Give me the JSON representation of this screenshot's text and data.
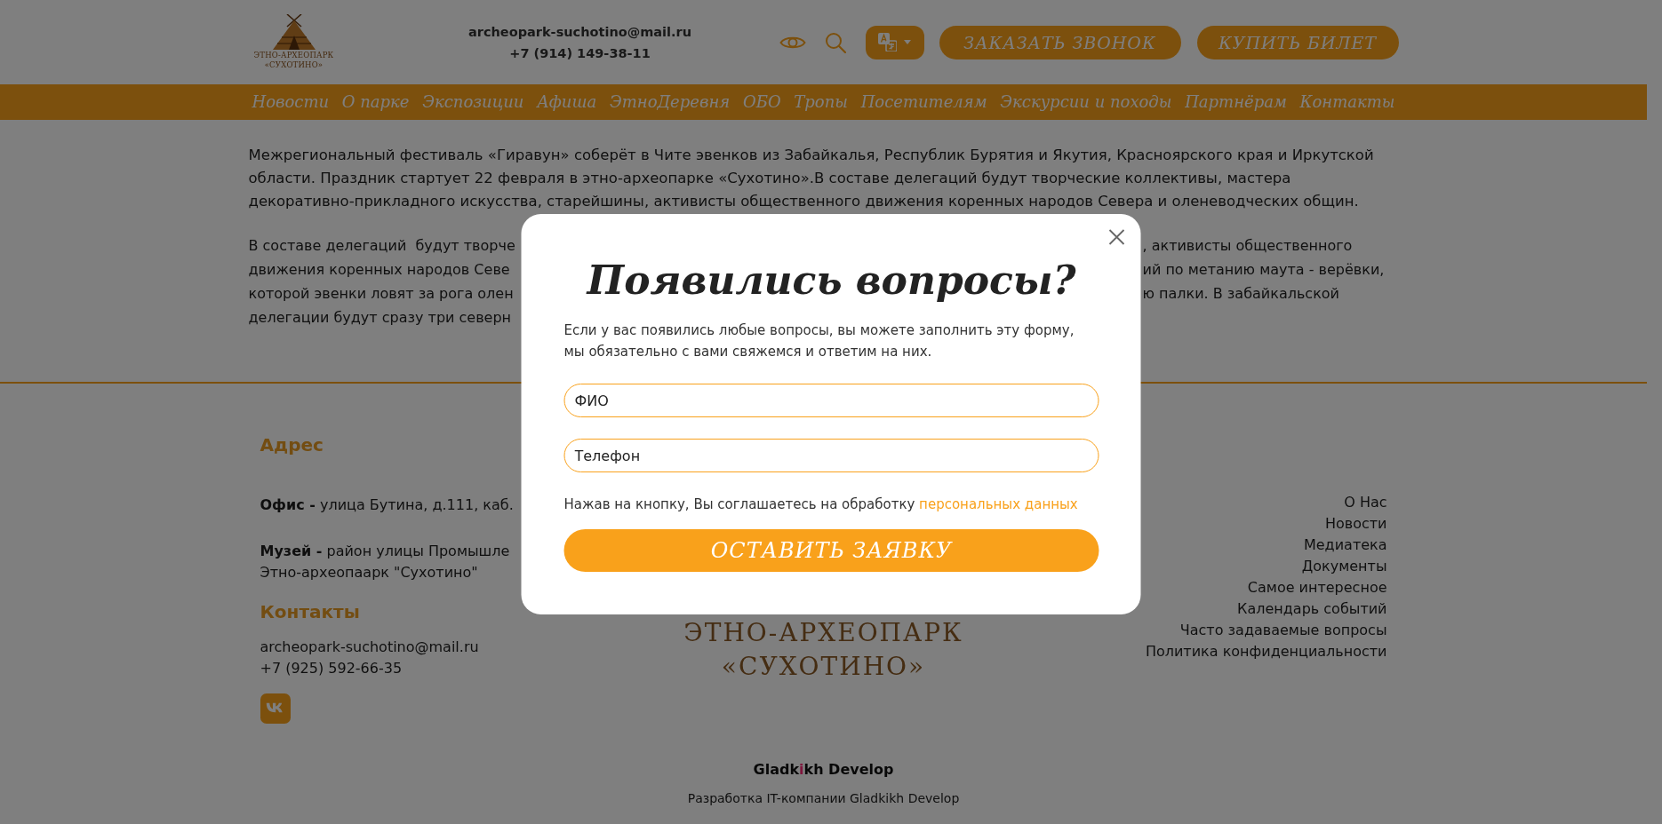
{
  "header": {
    "logo": {
      "lines": [
        "ЭТНО-АРХЕОПАРК",
        "«СУХОТИНО»"
      ]
    },
    "email": "archeopark-suchotino@mail.ru",
    "phone": "+7 (914) 149-38-11",
    "buttons": [
      "ЗАКАЗАТЬ ЗВОНОК",
      "КУПИТЬ БИЛЕТ"
    ]
  },
  "nav": {
    "items": [
      "Новости",
      "О парке",
      "Экспозиции",
      "Афиша",
      "ЭтноДеревня",
      "ОБО",
      "Тропы",
      "Посетителям",
      "Экскурсии и походы",
      "Партнёрам",
      "Контакты"
    ]
  },
  "article": {
    "paragraphs": [
      {
        "kind": "full",
        "text": "Межрегиональный фестиваль «Гиравун» соберёт в Чите эвенков из Забайкалья, Республик Бурятия и Якутия, Красноярского края и Иркутской области. Праздник стартует 22 февраля в этно-археопарке «Сухотино».В составе делегаций будут творческие коллективы, мастера декоративно-прикладного искусства, старейшины, активисты общественного движения коренных народов Севера и оленеводческих общин."
      },
      {
        "kind": "split",
        "lines": [
          {
            "left": "В составе делегаций  будут творче",
            "right": ", активисты общественного"
          },
          {
            "left": "движения коренных народов Севе",
            "right": "ий по метанию маута - верёвки,"
          },
          {
            "left": "которой эвенки ловят за рога олен",
            "right": "ю палки. В забайкальской"
          },
          {
            "left": "делегации будут сразу три северн"
          }
        ]
      }
    ]
  },
  "footer": {
    "address": {
      "heading": "Адрес",
      "entries": [
        {
          "lines": [
            "**Офис -** улица Бутина, д.111, каб."
          ]
        },
        {
          "lines": [
            "**Музей -** район улицы Промышле",
            "Этно-археопаарк \"Сухотино\""
          ]
        }
      ]
    },
    "contacts": {
      "heading": "Контакты",
      "email": "archeopark-suchotino@mail.ru",
      "phone": "+7 (925) 592-66-35"
    },
    "logo": {
      "lines": [
        "ЭТНО-АРХЕОПАРК",
        "«СУХОТИНО»"
      ]
    },
    "links": [
      "О Нас",
      "Новости",
      "Медиатека",
      "Документы",
      "Самое интересное",
      "Календарь событий",
      "Часто задаваемые вопросы",
      "Политика конфиденциальности"
    ],
    "developer": {
      "logo": [
        {
          "text": "Gladk",
          "accent": false
        },
        {
          "text": "i",
          "accent": true
        },
        {
          "text": "kh Develop",
          "accent": false
        }
      ],
      "caption": "Разработка IT-компании Gladkikh Develop"
    }
  },
  "modal": {
    "open": true,
    "title": "Появились вопросы?",
    "description": "Если у вас появились любые вопросы, вы можете заполнить эту форму, мы обязательно с вами свяжемся и ответим на них.",
    "fields": [
      {
        "placeholder": "ФИО"
      },
      {
        "placeholder": "Телефон"
      }
    ],
    "consent": {
      "text": "Нажав на кнопку, Вы соглашаетесь на обработку",
      "link": "персональных данных"
    },
    "submit": "ОСТАВИТЬ ЗАЯВКУ"
  }
}
